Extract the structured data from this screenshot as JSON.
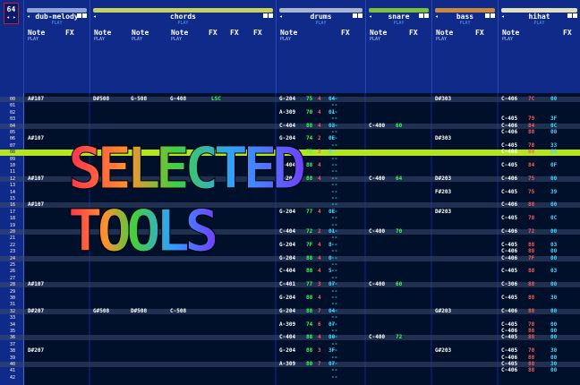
{
  "pattern": {
    "number": "64",
    "arrows": "◂ ▸"
  },
  "colors": {
    "background": "#0a1a66",
    "accent_green": "#b5e61d",
    "note": "#ffffff",
    "vol_green": "#3cff5a",
    "vol_red": "#ff5a5a",
    "fx_cyan": "#40d8ff"
  },
  "tracks": [
    {
      "name": "dub-melody",
      "play": "PLAY",
      "bar_color": "#8fa4d8",
      "columns": [
        {
          "label": "Note",
          "sub": "PLAY"
        },
        {
          "label": "FX",
          "sub": ""
        }
      ]
    },
    {
      "name": "chords",
      "play": "PLAY",
      "bar_color": "#c8d260",
      "columns": [
        {
          "label": "Note",
          "sub": "PLAY"
        },
        {
          "label": "Note",
          "sub": "PLAY"
        },
        {
          "label": "Note",
          "sub": "PLAY"
        },
        {
          "label": "FX",
          "sub": ""
        },
        {
          "label": "FX",
          "sub": ""
        },
        {
          "label": "FX",
          "sub": ""
        }
      ]
    },
    {
      "name": "drums",
      "play": "PLAY",
      "bar_color": "#a8b4d0",
      "columns": [
        {
          "label": "Note",
          "sub": "PLAY"
        },
        {
          "label": "FX",
          "sub": ""
        }
      ]
    },
    {
      "name": "snare",
      "play": "PLAY",
      "bar_color": "#7ac23c",
      "columns": [
        {
          "label": "Note",
          "sub": "PLAY"
        },
        {
          "label": "FX",
          "sub": ""
        }
      ]
    },
    {
      "name": "bass",
      "play": "PLAY",
      "bar_color": "#c88a40",
      "columns": [
        {
          "label": "Note",
          "sub": "PLAY"
        },
        {
          "label": "FX",
          "sub": ""
        }
      ]
    },
    {
      "name": "hihat",
      "play": "PLAY",
      "bar_color": "#e0e0c0",
      "columns": [
        {
          "label": "Note",
          "sub": "PLAY"
        },
        {
          "label": "FX",
          "sub": ""
        }
      ]
    }
  ],
  "rows": [
    "00",
    "01",
    "02",
    "03",
    "04",
    "05",
    "06",
    "07",
    "08",
    "09",
    "10",
    "11",
    "12",
    "13",
    "14",
    "15",
    "16",
    "17",
    "18",
    "19",
    "20",
    "21",
    "22",
    "23",
    "24",
    "25",
    "26",
    "27",
    "28",
    "29",
    "30",
    "31",
    "32",
    "33",
    "34",
    "35",
    "36",
    "37",
    "38",
    "39",
    "40",
    "41",
    "42"
  ],
  "cells": {
    "melody": [
      {
        "row": 0,
        "text": "A#107"
      },
      {
        "row": 6,
        "text": "A#107"
      },
      {
        "row": 12,
        "text": "A#107"
      },
      {
        "row": 16,
        "text": "A#107"
      },
      {
        "row": 28,
        "text": "A#107"
      },
      {
        "row": 32,
        "text": "D#207"
      },
      {
        "row": 38,
        "text": "D#207"
      }
    ],
    "chords": [
      {
        "row": 0,
        "a": "D#508",
        "b": "G-508",
        "c": "G-408",
        "fx": "LSC"
      },
      {
        "row": 32,
        "a": "G#508",
        "b": "D#508",
        "c": "C-508",
        "fx": ""
      }
    ],
    "drums": [
      {
        "row": 0,
        "note": "G-204",
        "v1": "75",
        "v2": "4",
        "fx": "04"
      },
      {
        "row": 2,
        "note": "A-309",
        "v1": "70",
        "v2": "4",
        "fx": "01"
      },
      {
        "row": 4,
        "note": "C-404",
        "v1": "88",
        "v2": "4",
        "fx": "03"
      },
      {
        "row": 6,
        "note": "G-204",
        "v1": "74",
        "v2": "2",
        "fx": "0E"
      },
      {
        "row": 8,
        "note": "A-309",
        "v1": "7B",
        "v2": "3",
        "fx": "0"
      },
      {
        "row": 10,
        "note": "C-404",
        "v1": "88",
        "v2": "4",
        "fx": ""
      },
      {
        "row": 12,
        "note": "G-204",
        "v1": "88",
        "v2": "4",
        "fx": ""
      },
      {
        "row": 17,
        "note": "G-204",
        "v1": "77",
        "v2": "4",
        "fx": "0E"
      },
      {
        "row": 20,
        "note": "C-404",
        "v1": "72",
        "v2": "2",
        "fx": "01"
      },
      {
        "row": 22,
        "note": "G-204",
        "v1": "7F",
        "v2": "4",
        "fx": "8"
      },
      {
        "row": 24,
        "note": "G-204",
        "v1": "88",
        "v2": "4",
        "fx": "0"
      },
      {
        "row": 26,
        "note": "C-404",
        "v1": "88",
        "v2": "4",
        "fx": "5"
      },
      {
        "row": 28,
        "note": "C-401",
        "v1": "77",
        "v2": "3",
        "fx": "07"
      },
      {
        "row": 30,
        "note": "G-204",
        "v1": "88",
        "v2": "4",
        "fx": ""
      },
      {
        "row": 32,
        "note": "G-204",
        "v1": "88",
        "v2": "7",
        "fx": "04"
      },
      {
        "row": 34,
        "note": "A-309",
        "v1": "74",
        "v2": "6",
        "fx": "07"
      },
      {
        "row": 36,
        "note": "C-404",
        "v1": "88",
        "v2": "4",
        "fx": "00"
      },
      {
        "row": 38,
        "note": "G-204",
        "v1": "88",
        "v2": "3",
        "fx": "3F"
      },
      {
        "row": 40,
        "note": "A-309",
        "v1": "80",
        "v2": "7",
        "fx": "07"
      }
    ],
    "snare": [
      {
        "row": 4,
        "text": "C-400",
        "v": "60"
      },
      {
        "row": 12,
        "text": "C-400",
        "v": "64"
      },
      {
        "row": 20,
        "text": "C-400",
        "v": "70"
      },
      {
        "row": 28,
        "text": "C-400",
        "v": "60"
      },
      {
        "row": 36,
        "text": "C-400",
        "v": "72"
      }
    ],
    "bass": [
      {
        "row": 0,
        "text": "D#303"
      },
      {
        "row": 6,
        "text": "D#303"
      },
      {
        "row": 12,
        "text": "D#203"
      },
      {
        "row": 14,
        "text": "F#203"
      },
      {
        "row": 17,
        "text": "D#203"
      },
      {
        "row": 32,
        "text": "G#203"
      },
      {
        "row": 38,
        "text": "G#203"
      }
    ],
    "hihat": [
      {
        "row": 0,
        "note": "C-406",
        "v": "7C",
        "fx": "00"
      },
      {
        "row": 3,
        "note": "C-405",
        "v": "79",
        "fx": "3F"
      },
      {
        "row": 4,
        "note": "C-406",
        "v": "84",
        "fx": "0C"
      },
      {
        "row": 5,
        "note": "C-406",
        "v": "88",
        "fx": "00"
      },
      {
        "row": 7,
        "note": "C-405",
        "v": "78",
        "fx": "33"
      },
      {
        "row": 8,
        "note": "C-406",
        "v": "88",
        "fx": "00"
      },
      {
        "row": 10,
        "note": "C-405",
        "v": "84",
        "fx": "0F"
      },
      {
        "row": 12,
        "note": "C-406",
        "v": "75",
        "fx": "00"
      },
      {
        "row": 14,
        "note": "C-405",
        "v": "75",
        "fx": "39"
      },
      {
        "row": 16,
        "note": "C-406",
        "v": "88",
        "fx": "00"
      },
      {
        "row": 18,
        "note": "C-405",
        "v": "78",
        "fx": "0C"
      },
      {
        "row": 20,
        "note": "C-406",
        "v": "72",
        "fx": "00"
      },
      {
        "row": 22,
        "note": "C-405",
        "v": "88",
        "fx": "03"
      },
      {
        "row": 23,
        "note": "C-406",
        "v": "88",
        "fx": "00"
      },
      {
        "row": 24,
        "note": "C-406",
        "v": "7F",
        "fx": "00"
      },
      {
        "row": 26,
        "note": "C-405",
        "v": "88",
        "fx": "03"
      },
      {
        "row": 28,
        "note": "C-306",
        "v": "88",
        "fx": "00"
      },
      {
        "row": 30,
        "note": "C-405",
        "v": "88",
        "fx": "30"
      },
      {
        "row": 32,
        "note": "C-406",
        "v": "88",
        "fx": "00"
      },
      {
        "row": 34,
        "note": "C-405",
        "v": "78",
        "fx": "00"
      },
      {
        "row": 35,
        "note": "C-406",
        "v": "88",
        "fx": "00"
      },
      {
        "row": 36,
        "note": "C-405",
        "v": "88",
        "fx": "00"
      },
      {
        "row": 38,
        "note": "C-405",
        "v": "70",
        "fx": "30"
      },
      {
        "row": 39,
        "note": "C-406",
        "v": "88",
        "fx": "00"
      },
      {
        "row": 40,
        "note": "C-405",
        "v": "88",
        "fx": "30"
      },
      {
        "row": 41,
        "note": "C-406",
        "v": "88",
        "fx": "00"
      }
    ]
  },
  "overlay": {
    "line1": "SELECTED",
    "line2": "TOOLS"
  }
}
